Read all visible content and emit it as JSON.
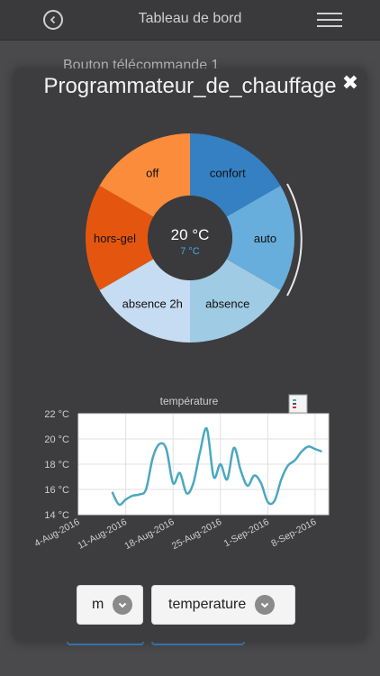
{
  "header": {
    "title": "Tableau de bord"
  },
  "background": {
    "label": "Bouton télécommande 1"
  },
  "modal": {
    "title": "Programmateur_de_chauffage",
    "close_glyph": "✖",
    "center_temp": "20 °C",
    "center_sub_temp": "7 °C",
    "modes": [
      {
        "label": "confort",
        "color": "#3580c2"
      },
      {
        "label": "auto",
        "color": "#67aedc"
      },
      {
        "label": "absence",
        "color": "#9fcbe4"
      },
      {
        "label": "absence 2h",
        "color": "#c6dcf2"
      },
      {
        "label": "hors-gel",
        "color": "#e4560f"
      },
      {
        "label": "off",
        "color": "#fb8c3b"
      }
    ],
    "dropdown_left": "m",
    "dropdown_right": "temperature"
  },
  "chart_data": {
    "type": "line",
    "title": "température",
    "y_unit": "°C",
    "ylim": [
      14,
      22
    ],
    "y_ticks": [
      "22 °C",
      "20 °C",
      "18 °C",
      "16 °C",
      "14 °C"
    ],
    "x_ticks": [
      "4-Aug-2016",
      "11-Aug-2016",
      "18-Aug-2016",
      "25-Aug-2016",
      "1-Sep-2016",
      "8-Sep-2016"
    ],
    "grid": true,
    "legend": "top-right",
    "line_color": "#4aa8c0",
    "x": [
      "2016-08-09",
      "2016-08-10",
      "2016-08-11",
      "2016-08-12",
      "2016-08-13",
      "2016-08-14",
      "2016-08-15",
      "2016-08-16",
      "2016-08-17",
      "2016-08-18",
      "2016-08-19",
      "2016-08-20",
      "2016-08-21",
      "2016-08-22",
      "2016-08-23",
      "2016-08-24",
      "2016-08-25",
      "2016-08-26",
      "2016-08-27",
      "2016-08-28",
      "2016-08-29",
      "2016-08-30",
      "2016-08-31",
      "2016-09-01",
      "2016-09-02",
      "2016-09-03",
      "2016-09-04",
      "2016-09-05",
      "2016-09-06",
      "2016-09-07",
      "2016-09-08",
      "2016-09-09"
    ],
    "values": [
      15.8,
      14.8,
      15.2,
      15.5,
      15.6,
      16.0,
      18.5,
      19.6,
      19.2,
      16.5,
      17.3,
      15.7,
      16.5,
      19.0,
      20.8,
      17.0,
      18.0,
      16.8,
      19.3,
      17.5,
      16.3,
      17.1,
      16.5,
      15.0,
      15.1,
      16.8,
      17.9,
      18.3,
      19.0,
      19.4,
      19.2,
      19.0
    ]
  }
}
